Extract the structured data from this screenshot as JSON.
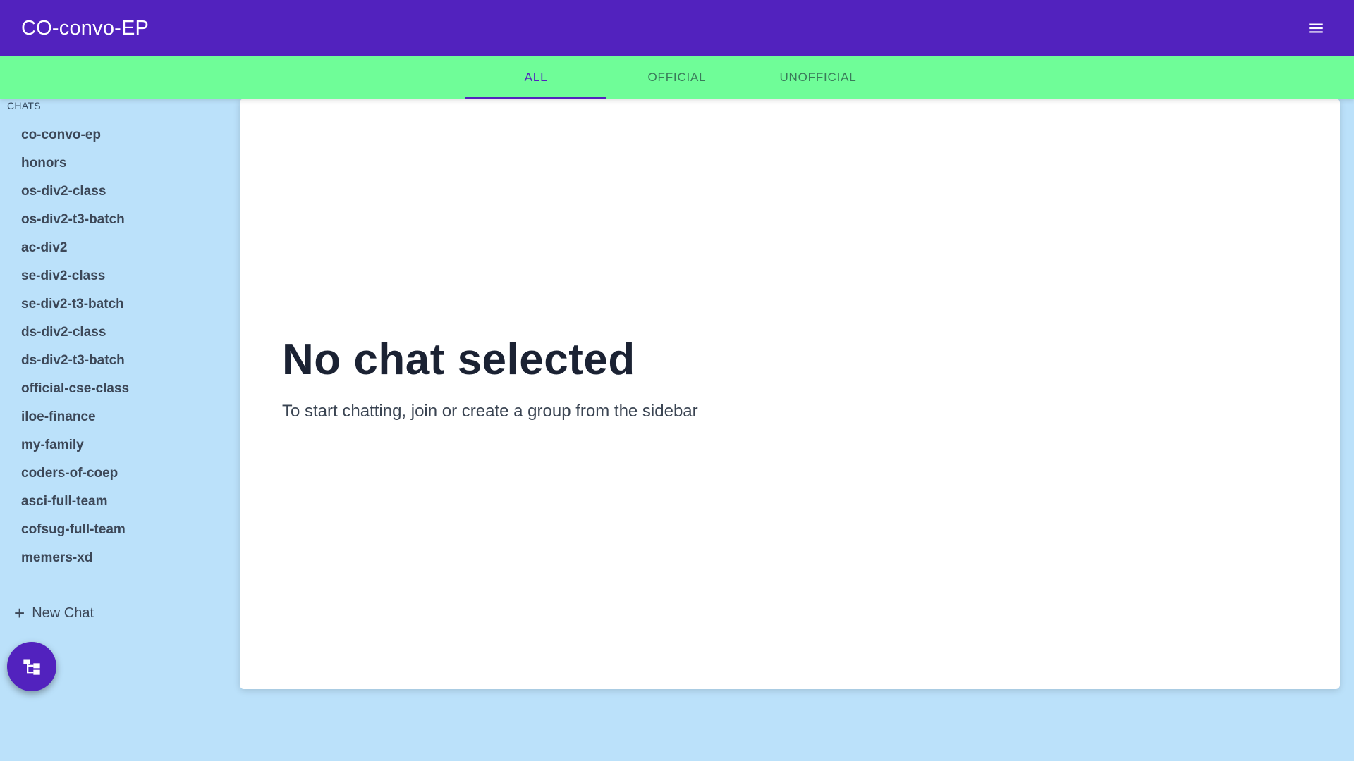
{
  "app_bar": {
    "title": "CO-convo-EP",
    "menu_icon": "hamburger-menu-icon",
    "background_color": "#5222be"
  },
  "tabs": {
    "background_color": "#6ffd98",
    "items": [
      {
        "label": "ALL",
        "active": true
      },
      {
        "label": "OFFICIAL",
        "active": false
      },
      {
        "label": "UNOFFICIAL",
        "active": false
      }
    ]
  },
  "sidebar": {
    "header": "CHATS",
    "chats": [
      "co-convo-ep",
      "honors",
      "os-div2-class",
      "os-div2-t3-batch",
      "ac-div2",
      "se-div2-class",
      "se-div2-t3-batch",
      "ds-div2-class",
      "ds-div2-t3-batch",
      "official-cse-class",
      "iloe-finance",
      "my-family",
      "coders-of-coep",
      "asci-full-team",
      "cofsug-full-team",
      "memers-xd"
    ],
    "new_chat_label": "New Chat",
    "new_chat_icon": "plus-icon",
    "fab_icon": "sitemap-icon"
  },
  "main": {
    "title": "No chat selected",
    "subtitle": "To start chatting, join or create a group from the sidebar"
  }
}
